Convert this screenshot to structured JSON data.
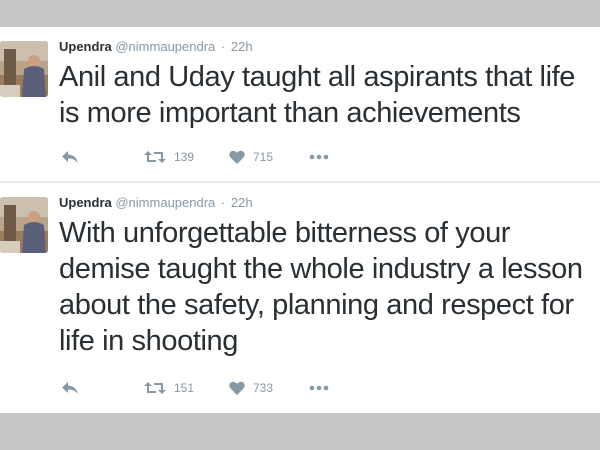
{
  "tweets": [
    {
      "name": "Upendra",
      "handle": "@nimmaupendra",
      "separator": "·",
      "time": "22h",
      "text": "Anil and Uday taught all aspirants that life is more important than achievements",
      "retweets": "139",
      "likes": "715",
      "icons": [
        "reply-icon",
        "retweet-icon",
        "heart-icon",
        "more-icon"
      ]
    },
    {
      "name": "Upendra",
      "handle": "@nimmaupendra",
      "separator": "·",
      "time": "22h",
      "text": "With unforgettable bitterness of your demise taught the whole industry a lesson about the safety, planning and respect for life in shooting",
      "retweets": "151",
      "likes": "733",
      "icons": [
        "reply-icon",
        "retweet-icon",
        "heart-icon",
        "more-icon"
      ]
    }
  ],
  "colors": {
    "background": "#c4c4c4",
    "card": "#ffffff",
    "text": "#292f33",
    "muted": "#8899a6"
  }
}
